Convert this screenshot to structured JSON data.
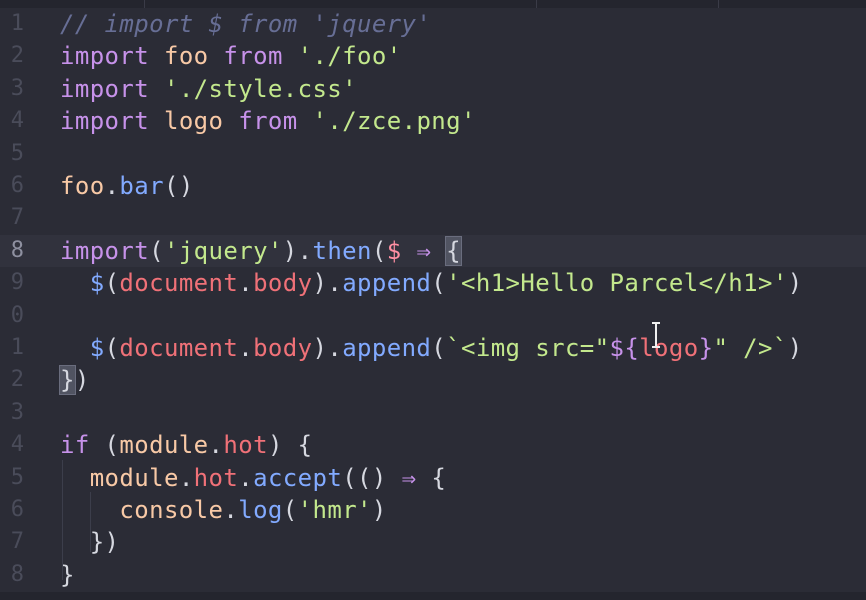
{
  "editor": {
    "lines": [
      {
        "num": "1",
        "tokens": [
          {
            "t": "// import $ from 'jquery'",
            "c": "cm"
          }
        ]
      },
      {
        "num": "2",
        "tokens": [
          {
            "t": "import",
            "c": "kw"
          },
          {
            "t": " "
          },
          {
            "t": "foo",
            "c": "var"
          },
          {
            "t": " "
          },
          {
            "t": "from",
            "c": "kw"
          },
          {
            "t": " "
          },
          {
            "t": "'./foo'",
            "c": "str"
          }
        ]
      },
      {
        "num": "3",
        "tokens": [
          {
            "t": "import",
            "c": "kw"
          },
          {
            "t": " "
          },
          {
            "t": "'./style.css'",
            "c": "str"
          }
        ]
      },
      {
        "num": "4",
        "tokens": [
          {
            "t": "import",
            "c": "kw"
          },
          {
            "t": " "
          },
          {
            "t": "logo",
            "c": "var"
          },
          {
            "t": " "
          },
          {
            "t": "from",
            "c": "kw"
          },
          {
            "t": " "
          },
          {
            "t": "'./zce.png'",
            "c": "str"
          }
        ]
      },
      {
        "num": "5",
        "tokens": []
      },
      {
        "num": "6",
        "tokens": [
          {
            "t": "foo",
            "c": "var"
          },
          {
            "t": ".",
            "c": "punc"
          },
          {
            "t": "bar",
            "c": "fn"
          },
          {
            "t": "()",
            "c": "punc"
          }
        ]
      },
      {
        "num": "7",
        "tokens": []
      },
      {
        "num": "8",
        "current": true,
        "tokens": [
          {
            "t": "import",
            "c": "kw"
          },
          {
            "t": "(",
            "c": "punc"
          },
          {
            "t": "'jquery'",
            "c": "str"
          },
          {
            "t": ").",
            "c": "punc"
          },
          {
            "t": "then",
            "c": "fn"
          },
          {
            "t": "(",
            "c": "punc"
          },
          {
            "t": "$",
            "c": "param"
          },
          {
            "t": " "
          },
          {
            "t": "⇒",
            "c": "kw"
          },
          {
            "t": " "
          },
          {
            "t": "{",
            "c": "punc",
            "hl": true
          }
        ]
      },
      {
        "num": "9",
        "tokens": [
          {
            "t": "  "
          },
          {
            "t": "$",
            "c": "fn"
          },
          {
            "t": "(",
            "c": "punc"
          },
          {
            "t": "document",
            "c": "obj"
          },
          {
            "t": ".",
            "c": "punc"
          },
          {
            "t": "body",
            "c": "obj"
          },
          {
            "t": ").",
            "c": "punc"
          },
          {
            "t": "append",
            "c": "fn"
          },
          {
            "t": "(",
            "c": "punc"
          },
          {
            "t": "'<h1>Hello Parcel</h1>'",
            "c": "str"
          },
          {
            "t": ")",
            "c": "punc"
          }
        ]
      },
      {
        "num": "0",
        "tokens": []
      },
      {
        "num": "1",
        "tokens": [
          {
            "t": "  "
          },
          {
            "t": "$",
            "c": "fn"
          },
          {
            "t": "(",
            "c": "punc"
          },
          {
            "t": "document",
            "c": "obj"
          },
          {
            "t": ".",
            "c": "punc"
          },
          {
            "t": "body",
            "c": "obj"
          },
          {
            "t": ").",
            "c": "punc"
          },
          {
            "t": "append",
            "c": "fn"
          },
          {
            "t": "(",
            "c": "punc"
          },
          {
            "t": "`<img src=\"",
            "c": "str"
          },
          {
            "t": "${",
            "c": "interp"
          },
          {
            "t": "logo",
            "c": "ivar"
          },
          {
            "t": "}",
            "c": "interp"
          },
          {
            "t": "\" />`",
            "c": "str"
          },
          {
            "t": ")",
            "c": "punc"
          }
        ]
      },
      {
        "num": "2",
        "tokens": [
          {
            "t": "}",
            "c": "punc",
            "hl": true
          },
          {
            "t": ")",
            "c": "punc"
          }
        ]
      },
      {
        "num": "3",
        "tokens": []
      },
      {
        "num": "4",
        "tokens": [
          {
            "t": "if",
            "c": "kw"
          },
          {
            "t": " (",
            "c": "punc"
          },
          {
            "t": "module",
            "c": "var"
          },
          {
            "t": ".",
            "c": "punc"
          },
          {
            "t": "hot",
            "c": "obj"
          },
          {
            "t": ") {",
            "c": "punc"
          }
        ]
      },
      {
        "num": "5",
        "tokens": [
          {
            "t": "  "
          },
          {
            "t": "module",
            "c": "var"
          },
          {
            "t": ".",
            "c": "punc"
          },
          {
            "t": "hot",
            "c": "obj"
          },
          {
            "t": ".",
            "c": "punc"
          },
          {
            "t": "accept",
            "c": "fn"
          },
          {
            "t": "(() ",
            "c": "punc"
          },
          {
            "t": "⇒",
            "c": "kw"
          },
          {
            "t": " {",
            "c": "punc"
          }
        ]
      },
      {
        "num": "6",
        "tokens": [
          {
            "t": "    "
          },
          {
            "t": "console",
            "c": "var"
          },
          {
            "t": ".",
            "c": "punc"
          },
          {
            "t": "log",
            "c": "fn"
          },
          {
            "t": "(",
            "c": "punc"
          },
          {
            "t": "'hmr'",
            "c": "str"
          },
          {
            "t": ")",
            "c": "punc"
          }
        ]
      },
      {
        "num": "7",
        "tokens": [
          {
            "t": "  "
          },
          {
            "t": "})",
            "c": "punc"
          }
        ]
      },
      {
        "num": "8",
        "tokens": [
          {
            "t": "}",
            "c": "punc"
          }
        ]
      }
    ]
  }
}
